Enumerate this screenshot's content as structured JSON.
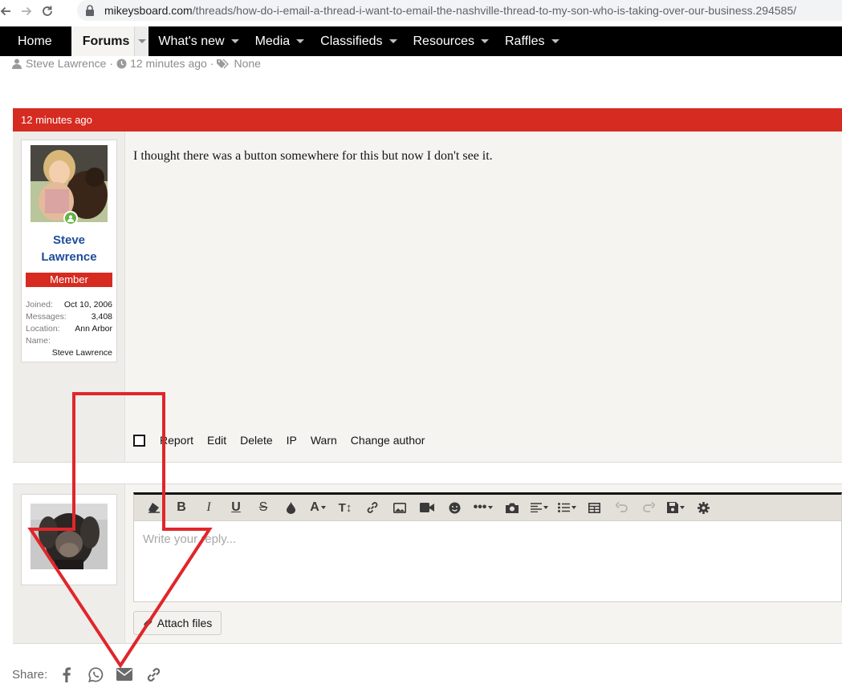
{
  "browser": {
    "url_host": "mikeysboard.com",
    "url_path": "/threads/how-do-i-email-a-thread-i-want-to-email-the-nashville-thread-to-my-son-who-is-taking-over-our-business.294585/"
  },
  "nav": {
    "items": [
      {
        "label": "Home"
      },
      {
        "label": "Forums"
      },
      {
        "label": "What's new"
      },
      {
        "label": "Media"
      },
      {
        "label": "Classifieds"
      },
      {
        "label": "Resources"
      },
      {
        "label": "Raffles"
      }
    ]
  },
  "thread_meta": {
    "author": "Steve Lawrence",
    "time": "12 minutes ago",
    "tags": "None",
    "separator": "·"
  },
  "post": {
    "header_time": "12 minutes ago",
    "username_line1": "Steve",
    "username_line2": "Lawrence",
    "user_title": "Member",
    "extras": [
      {
        "key": "Joined:",
        "value": "Oct 10, 2006"
      },
      {
        "key": "Messages:",
        "value": "3,408"
      },
      {
        "key": "Location:",
        "value": "Ann Arbor"
      },
      {
        "key": "Name:",
        "value": "Steve Lawrence"
      }
    ],
    "message": "I thought there was a button somewhere for this but now I don't see it.",
    "actions": [
      "Report",
      "Edit",
      "Delete",
      "IP",
      "Warn",
      "Change author"
    ]
  },
  "editor": {
    "placeholder": "Write your reply...",
    "attach_label": "Attach files",
    "toolbar": [
      {
        "icon": "eraser-icon",
        "glyph": "⌫"
      },
      {
        "icon": "bold-icon",
        "glyph": "B"
      },
      {
        "icon": "italic-icon",
        "glyph": "I"
      },
      {
        "icon": "underline-icon",
        "glyph": "U"
      },
      {
        "icon": "strike-icon",
        "glyph": "S"
      },
      {
        "icon": "color-icon",
        "glyph": "💧"
      },
      {
        "icon": "font-family-icon",
        "glyph": "A"
      },
      {
        "icon": "font-size-icon",
        "glyph": "TI"
      },
      {
        "icon": "link-icon",
        "glyph": "🔗"
      },
      {
        "icon": "image-icon",
        "glyph": "▣"
      },
      {
        "icon": "video-icon",
        "glyph": "■"
      },
      {
        "icon": "smiley-icon",
        "glyph": "☻"
      },
      {
        "icon": "more-icon",
        "glyph": "•••"
      },
      {
        "icon": "camera-icon",
        "glyph": "◙"
      },
      {
        "icon": "align-icon",
        "glyph": "≡"
      },
      {
        "icon": "list-icon",
        "glyph": "☰"
      },
      {
        "icon": "table-icon",
        "glyph": "⊞"
      },
      {
        "icon": "undo-icon",
        "glyph": "↶"
      },
      {
        "icon": "redo-icon",
        "glyph": "↷"
      },
      {
        "icon": "save-draft-icon",
        "glyph": "💾"
      },
      {
        "icon": "settings-icon",
        "glyph": "⚙"
      }
    ]
  },
  "share": {
    "label": "Share:",
    "icons": [
      "facebook-icon",
      "whatsapp-icon",
      "email-icon",
      "link-icon"
    ]
  },
  "colors": {
    "accent_red": "#d62b20",
    "nav_black": "#000000",
    "username_blue": "#1e4c9a",
    "annotation_red": "#e0262a"
  }
}
